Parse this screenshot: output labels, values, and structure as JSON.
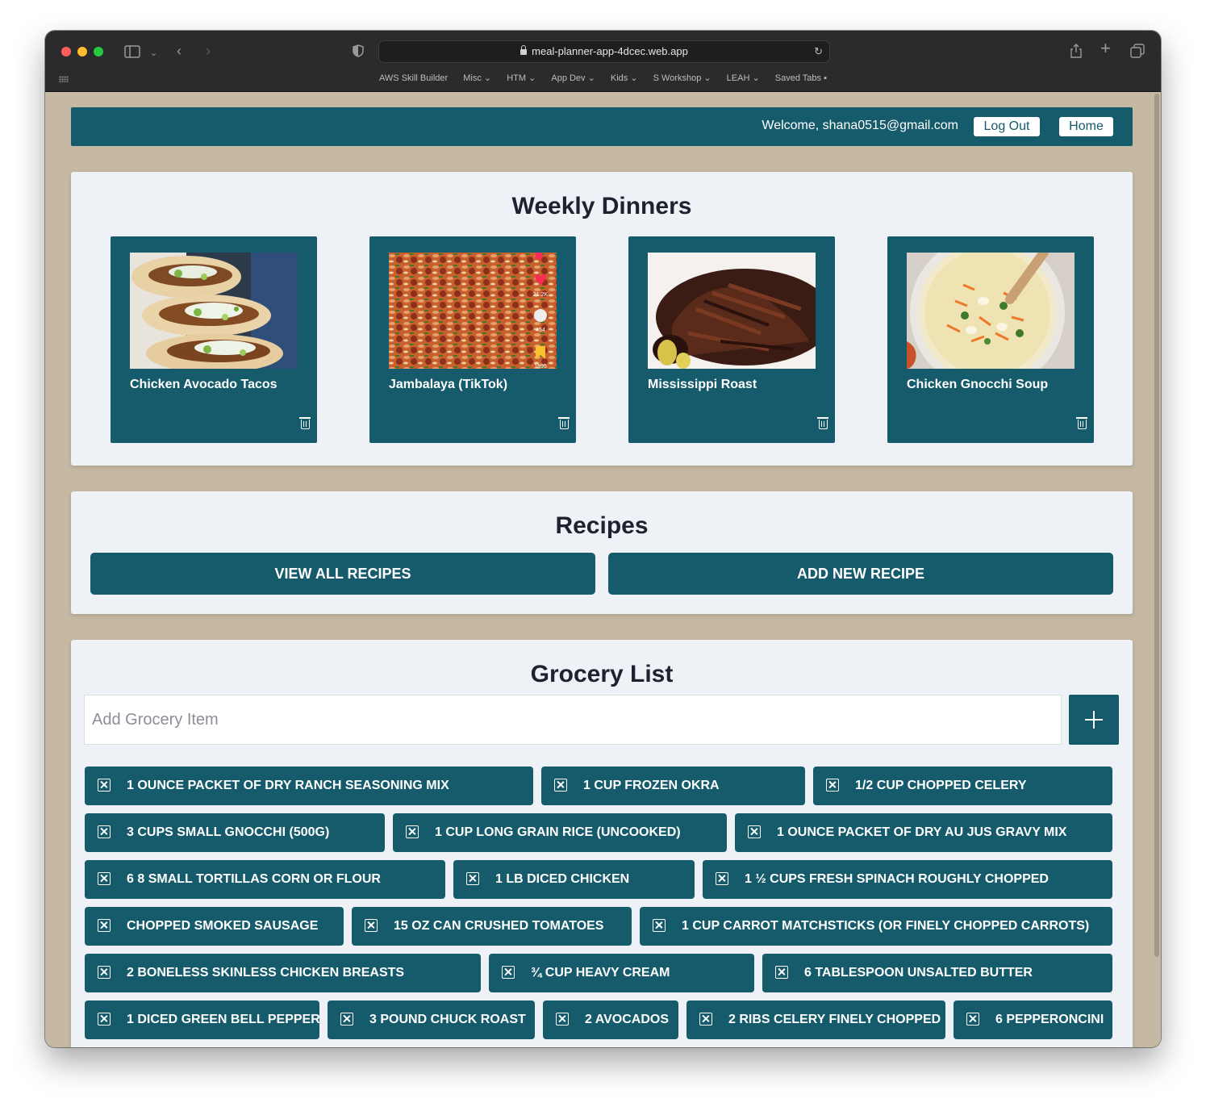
{
  "browser": {
    "url": "meal-planner-app-4dcec.web.app",
    "bookmarks": [
      "AWS Skill Builder",
      "Misc ⌄",
      "HTM ⌄",
      "App Dev ⌄",
      "Kids ⌄",
      "S Workshop ⌄",
      "LEAH ⌄",
      "Saved Tabs ▪"
    ]
  },
  "nav": {
    "welcome": "Welcome, shana0515@gmail.com",
    "logout_label": "Log Out",
    "home_label": "Home"
  },
  "weekly": {
    "title": "Weekly Dinners",
    "dinners": [
      {
        "name": "Chicken Avocado Tacos"
      },
      {
        "name": "Jambalaya (TikTok)"
      },
      {
        "name": "Mississippi Roast"
      },
      {
        "name": "Chicken Gnocchi Soup"
      }
    ],
    "tiktok_overlay": {
      "likes": "21.2K",
      "comments": "454",
      "saves": "1895"
    }
  },
  "recipes": {
    "title": "Recipes",
    "view_all_label": "VIEW ALL RECIPES",
    "add_new_label": "ADD NEW RECIPE"
  },
  "grocery": {
    "title": "Grocery List",
    "placeholder": "Add Grocery Item",
    "items": [
      "1 OUNCE PACKET OF DRY RANCH SEASONING MIX",
      "1 CUP FROZEN OKRA",
      "1/2 CUP CHOPPED CELERY",
      "3 CUPS SMALL GNOCCHI (500G)",
      "1 CUP LONG GRAIN RICE (UNCOOKED)",
      "1 OUNCE PACKET OF DRY AU JUS GRAVY MIX",
      "6 8 SMALL TORTILLAS CORN OR FLOUR",
      "1 LB DICED CHICKEN",
      "1 ½ CUPS FRESH SPINACH ROUGHLY CHOPPED",
      "CHOPPED SMOKED SAUSAGE",
      "15 OZ CAN CRUSHED TOMATOES",
      "1 CUP CARROT MATCHSTICKS (OR FINELY CHOPPED CARROTS)",
      "2 BONELESS SKINLESS CHICKEN BREASTS",
      "¾ CUP HEAVY CREAM",
      "6 TABLESPOON UNSALTED BUTTER",
      "1 DICED GREEN BELL PEPPER",
      "3 POUND CHUCK ROAST",
      "2 AVOCADOS",
      "2 RIBS CELERY FINELY CHOPPED",
      "6 PEPPERONCINI"
    ]
  },
  "colors": {
    "primary": "#155b6b",
    "page_bg": "#c6b9a3",
    "card_bg": "#eef1f6"
  }
}
